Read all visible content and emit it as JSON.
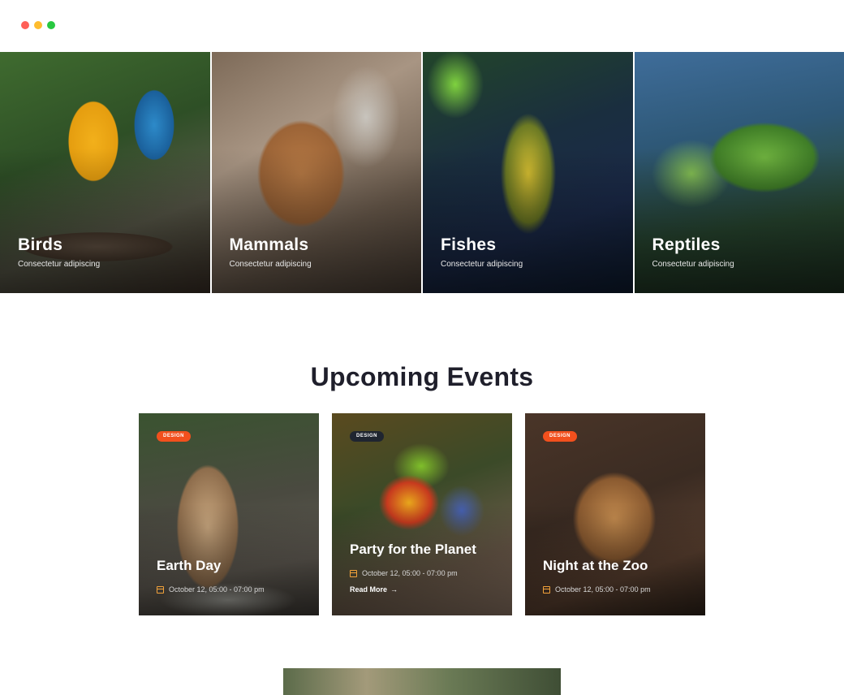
{
  "window": {
    "controls": [
      "close",
      "minimize",
      "maximize"
    ]
  },
  "categories": [
    {
      "title": "Birds",
      "subtitle": "Consectetur adipiscing"
    },
    {
      "title": "Mammals",
      "subtitle": "Consectetur adipiscing"
    },
    {
      "title": "Fishes",
      "subtitle": "Consectetur adipiscing"
    },
    {
      "title": "Reptiles",
      "subtitle": "Consectetur adipiscing"
    }
  ],
  "events_section": {
    "title": "Upcoming Events",
    "items": [
      {
        "badge": "DESIGN",
        "badge_color": "#f2501d",
        "title": "Earth Day",
        "date": "October 12, 05:00 - 07:00 pm"
      },
      {
        "badge": "DESIGN",
        "badge_color": "#1f2530",
        "title": "Party for the Planet",
        "date": "October 12, 05:00 - 07:00 pm",
        "link": "Read More"
      },
      {
        "badge": "DESIGN",
        "badge_color": "#f2501d",
        "title": "Night at the Zoo",
        "date": "October 12, 05:00 - 07:00 pm"
      }
    ]
  },
  "icons": {
    "calendar": "calendar-icon",
    "arrow": "arrow-right-icon"
  },
  "colors": {
    "accent": "#f2501d",
    "heading": "#1f1f2b"
  }
}
